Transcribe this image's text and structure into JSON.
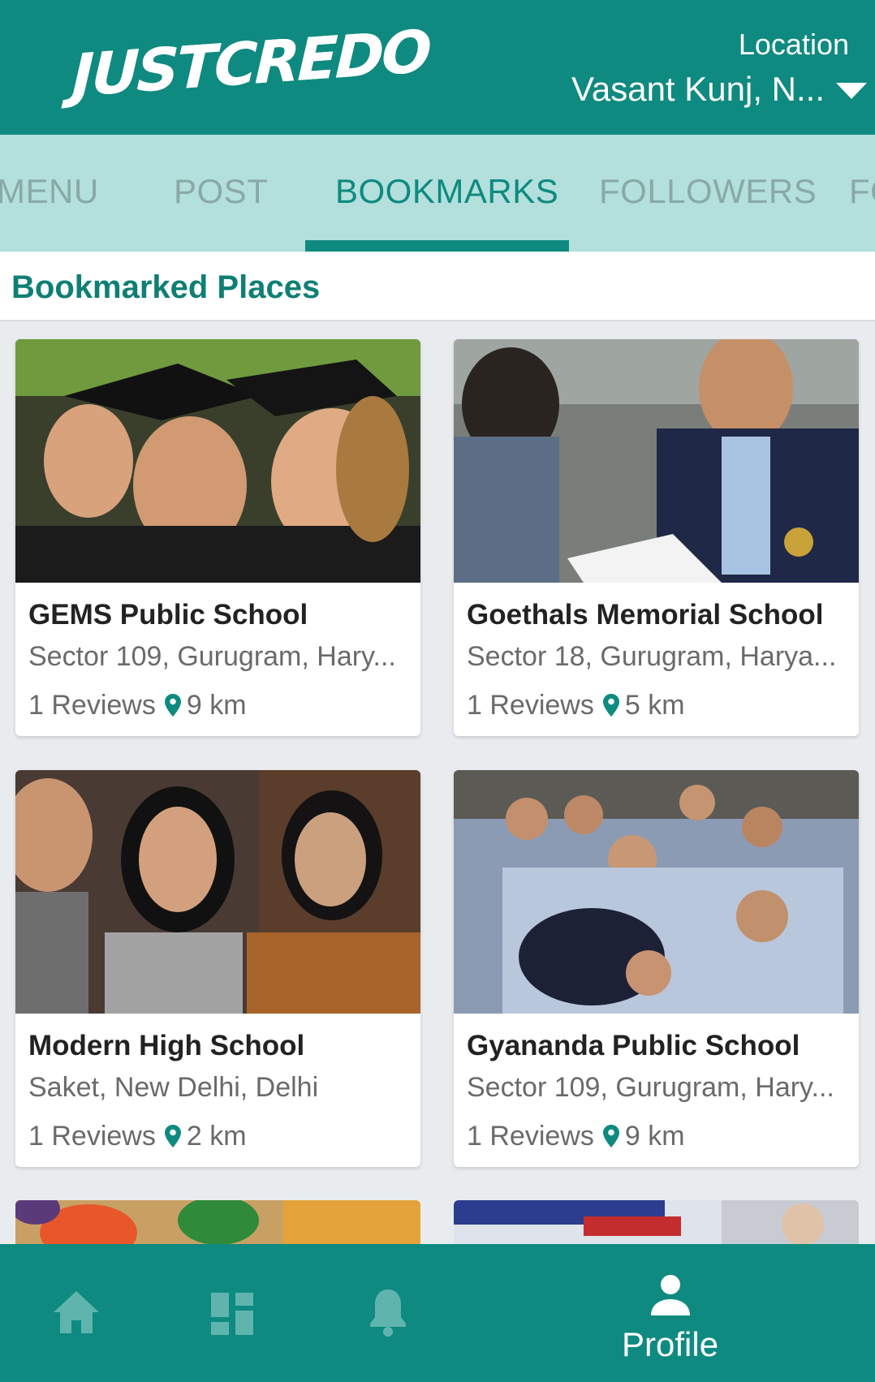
{
  "header": {
    "logo_text": "JUSTCREDO",
    "location_label": "Location",
    "location_value": "Vasant Kunj, N..."
  },
  "tabs": [
    {
      "label": "MENU"
    },
    {
      "label": "POST"
    },
    {
      "label": "BOOKMARKS",
      "active": true
    },
    {
      "label": "FOLLOWERS"
    },
    {
      "label": "FO"
    }
  ],
  "section": {
    "title": "Bookmarked Places"
  },
  "places": [
    {
      "name": "GEMS Public School",
      "address": "Sector 109, Gurugram, Hary...",
      "reviews": "1 Reviews",
      "distance": "9 km"
    },
    {
      "name": "Goethals Memorial School",
      "address": "Sector 18, Gurugram, Harya...",
      "reviews": "1 Reviews",
      "distance": "5 km"
    },
    {
      "name": "Modern High School",
      "address": "Saket, New Delhi, Delhi",
      "reviews": "1 Reviews",
      "distance": "2 km"
    },
    {
      "name": "Gyananda Public School",
      "address": "Sector 109, Gurugram, Hary...",
      "reviews": "1 Reviews",
      "distance": "9 km"
    }
  ],
  "bottom_nav": {
    "items": [
      {
        "icon": "home-icon"
      },
      {
        "icon": "dashboard-icon"
      },
      {
        "icon": "bell-icon"
      },
      {
        "icon": "profile-icon",
        "label": "Profile",
        "active": true
      }
    ]
  },
  "colors": {
    "primary": "#0f8a80",
    "tab_bar": "#b3e0dc",
    "inactive_tab": "#8aa9a6"
  }
}
